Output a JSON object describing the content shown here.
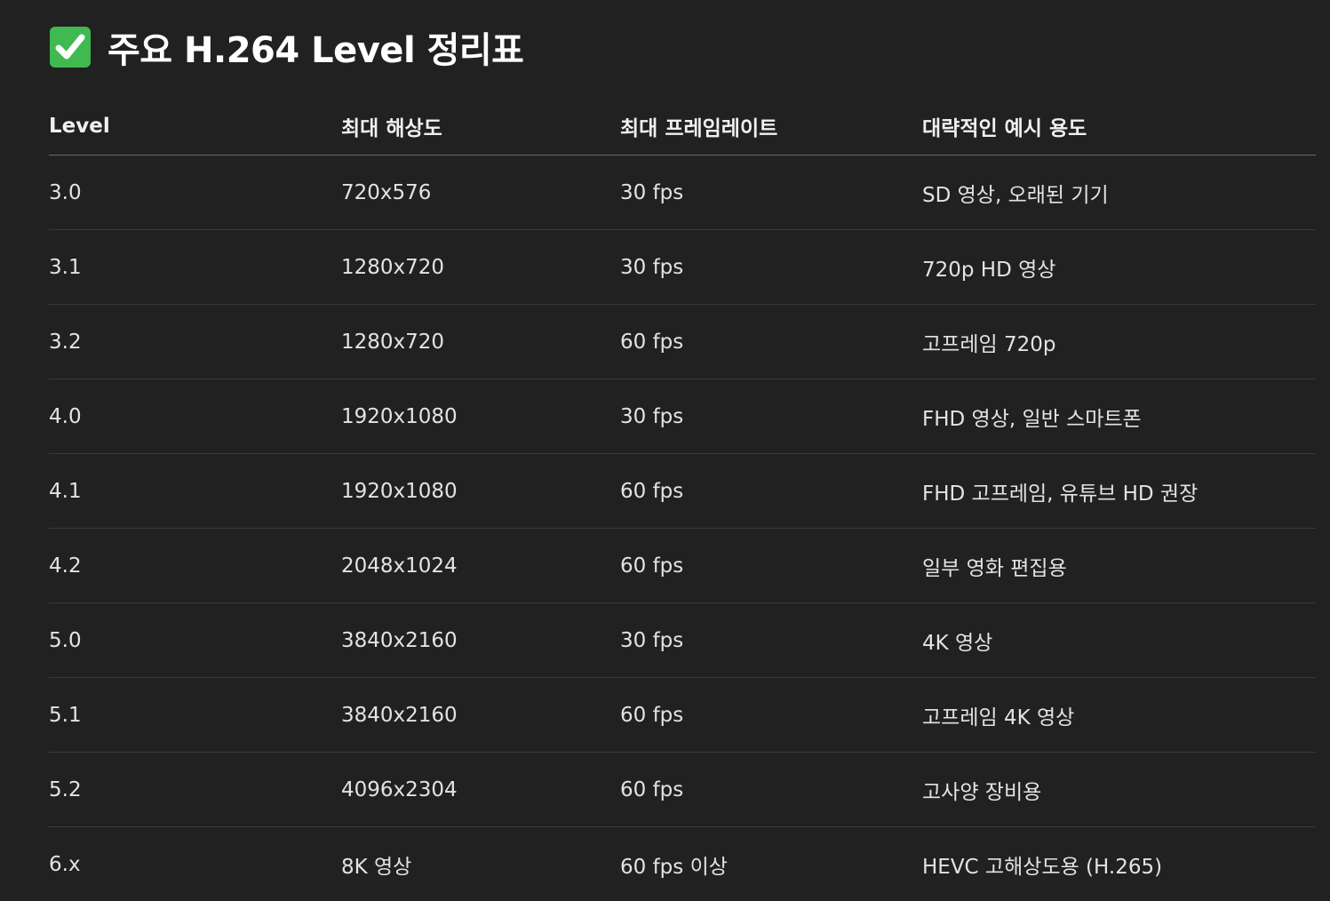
{
  "title": {
    "icon": "check-mark-button-icon",
    "text": "주요 H.264 Level 정리표"
  },
  "colors": {
    "background": "#212121",
    "check_green": "#3fb950",
    "text": "#e3e3e3"
  },
  "table": {
    "headers": [
      "Level",
      "최대 해상도",
      "최대 프레임레이트",
      "대략적인 예시 용도"
    ],
    "rows": [
      [
        "3.0",
        "720x576",
        "30 fps",
        "SD 영상, 오래된 기기"
      ],
      [
        "3.1",
        "1280x720",
        "30 fps",
        "720p HD 영상"
      ],
      [
        "3.2",
        "1280x720",
        "60 fps",
        "고프레임 720p"
      ],
      [
        "4.0",
        "1920x1080",
        "30 fps",
        "FHD 영상, 일반 스마트폰"
      ],
      [
        "4.1",
        "1920x1080",
        "60 fps",
        "FHD 고프레임, 유튜브 HD 권장"
      ],
      [
        "4.2",
        "2048x1024",
        "60 fps",
        "일부 영화 편집용"
      ],
      [
        "5.0",
        "3840x2160",
        "30 fps",
        "4K 영상"
      ],
      [
        "5.1",
        "3840x2160",
        "60 fps",
        "고프레임 4K 영상"
      ],
      [
        "5.2",
        "4096x2304",
        "60 fps",
        "고사양 장비용"
      ],
      [
        "6.x",
        "8K 영상",
        "60 fps 이상",
        "HEVC 고해상도용 (H.265)"
      ]
    ]
  }
}
